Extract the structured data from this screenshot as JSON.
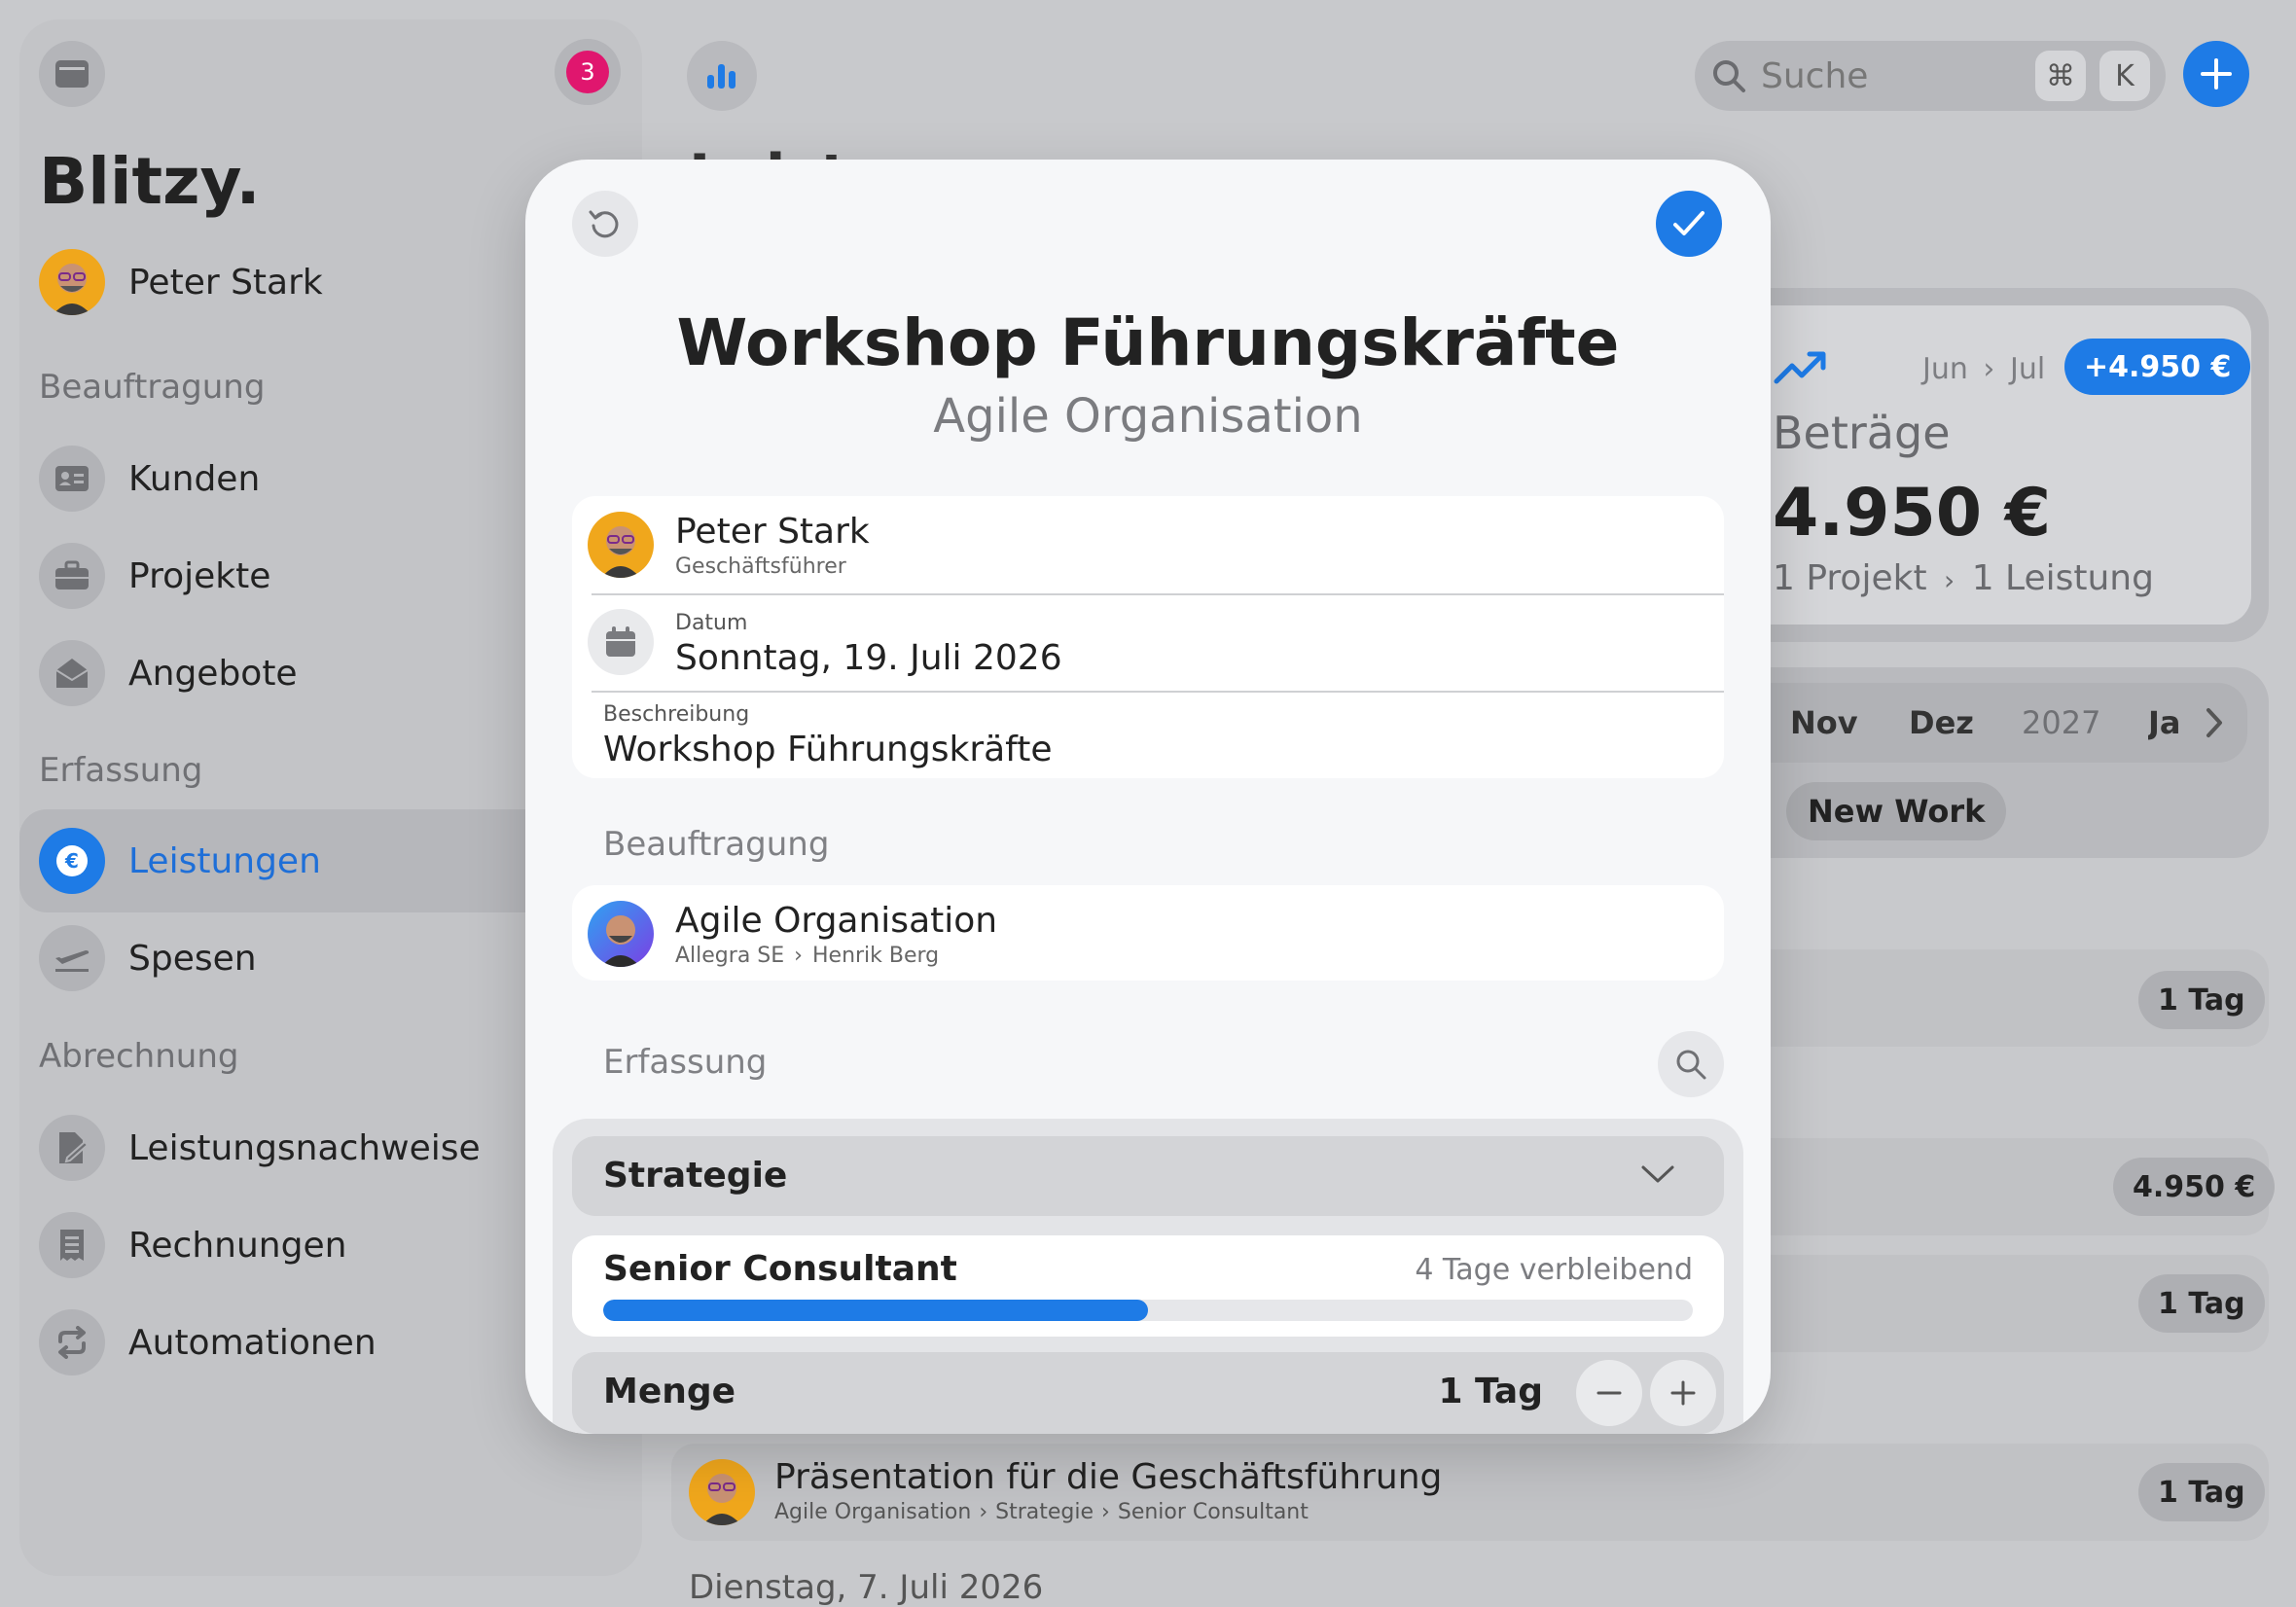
{
  "sidebar": {
    "notification_count": "3",
    "brand": "Blitzy.",
    "user_name": "Peter Stark",
    "sections": [
      {
        "title": "Beauftragung",
        "items": [
          {
            "label": "Kunden"
          },
          {
            "label": "Projekte"
          },
          {
            "label": "Angebote"
          }
        ]
      },
      {
        "title": "Erfassung",
        "items": [
          {
            "label": "Leistungen"
          },
          {
            "label": "Spesen"
          }
        ]
      },
      {
        "title": "Abrechnung",
        "items": [
          {
            "label": "Leistungsnachweise"
          },
          {
            "label": "Rechnungen"
          },
          {
            "label": "Automationen"
          }
        ]
      }
    ],
    "active_item": "Leistungen"
  },
  "topbar": {
    "search_placeholder": "Suche",
    "shortcut_cmd": "⌘",
    "shortcut_key": "K"
  },
  "background": {
    "page_title_peek": "Leist",
    "stats": {
      "range_from": "Jun",
      "range_to": "Jul",
      "delta": "+4.950 €",
      "title": "Beträge",
      "amount": "4.950 €",
      "projects": "1 Projekt",
      "services": "1 Leistung"
    },
    "months": [
      "Nov",
      "Dez",
      "2027",
      "Ja"
    ],
    "filter_chip": "New Work",
    "row_tags": [
      "1 Tag",
      "4.950 €",
      "1 Tag",
      "1 Tag"
    ],
    "list_item": {
      "title": "Präsentation für die Geschäftsführung",
      "breadcrumb": [
        "Agile Organisation",
        "Strategie",
        "Senior Consultant"
      ]
    },
    "date_header": "Dienstag, 7. Juli 2026"
  },
  "modal": {
    "title": "Workshop Führungskräfte",
    "subtitle": "Agile Organisation",
    "person": {
      "name": "Peter Stark",
      "role": "Geschäftsführer"
    },
    "date": {
      "label": "Datum",
      "value": "Sonntag, 19. Juli 2026"
    },
    "description": {
      "label": "Beschreibung",
      "value": "Workshop Führungskräfte"
    },
    "beauftragung_title": "Beauftragung",
    "engagement": {
      "name": "Agile Organisation",
      "company": "Allegra SE",
      "contact": "Henrik Berg"
    },
    "erfassung_title": "Erfassung",
    "category": "Strategie",
    "role": {
      "label": "Senior Consultant",
      "remaining": "4 Tage verbleibend",
      "progress": 0.5
    },
    "quantity": {
      "label": "Menge",
      "value": "1 Tag"
    }
  },
  "colors": {
    "accent": "#1e7be6",
    "badge": "#e0166e"
  }
}
